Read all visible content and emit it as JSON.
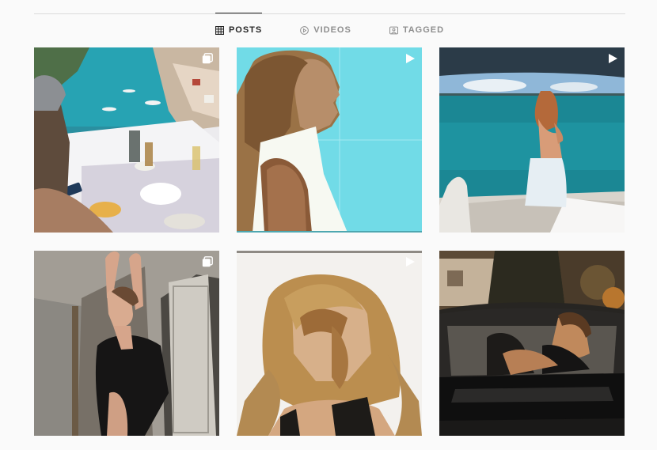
{
  "tabs": [
    {
      "label": "POSTS",
      "icon": "grid-icon",
      "active": true
    },
    {
      "label": "VIDEOS",
      "icon": "play-circle-icon",
      "active": false
    },
    {
      "label": "TAGGED",
      "icon": "tagged-icon",
      "active": false
    }
  ],
  "posts": [
    {
      "scene": "coastal-breakfast-table",
      "badge": "carousel-icon"
    },
    {
      "scene": "profile-woman-cyan-background",
      "badge": "video-icon"
    },
    {
      "scene": "woman-on-boat-deck",
      "badge": "video-icon"
    },
    {
      "scene": "woman-black-top-doorway",
      "badge": "carousel-icon"
    },
    {
      "scene": "woman-windblown-hair",
      "badge": "video-icon"
    },
    {
      "scene": "woman-in-vintage-car",
      "badge": "none"
    }
  ],
  "colors": {
    "background": "#fafafa",
    "divider": "#dbdbdb",
    "active_tab": "#262626",
    "inactive_tab": "#8e8e8e"
  }
}
